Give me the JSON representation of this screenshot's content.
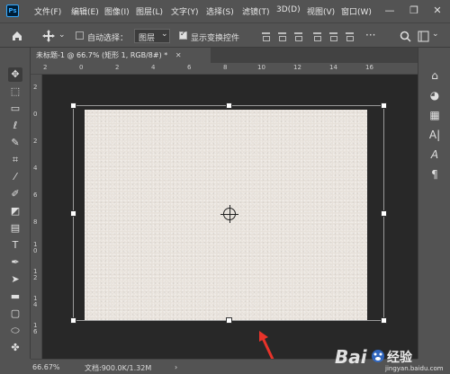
{
  "app": {
    "logo_text": "Ps"
  },
  "menu": {
    "items": [
      "文件(F)",
      "编辑(E)",
      "图像(I)",
      "图层(L)",
      "文字(Y)",
      "选择(S)",
      "滤镜(T)",
      "3D(D)",
      "视图(V)",
      "窗口(W)"
    ]
  },
  "window_controls": {
    "minimize": "—",
    "restore": "❐",
    "close": "✕"
  },
  "options": {
    "auto_select_label": "自动选择：",
    "auto_select_checked": false,
    "layer_select_value": "图层",
    "show_transform_label": "显示变换控件",
    "show_transform_checked": true
  },
  "document": {
    "tab_title": "未标题-1 @ 66.7% (矩形 1, RGB/8#) *",
    "canvas_color": "#e7e1da"
  },
  "rulers": {
    "top_labels": [
      "2",
      "0",
      "2",
      "4",
      "6",
      "8",
      "10",
      "12",
      "14",
      "16"
    ],
    "left_labels": [
      "2",
      "0",
      "2",
      "4",
      "6",
      "8",
      "1\n0",
      "1\n2",
      "1\n4",
      "1\n6"
    ]
  },
  "status": {
    "zoom": "66.67%",
    "doc_info": "文档:900.0K/1.32M"
  },
  "watermark": {
    "brand": "Bai",
    "suffix": "经验",
    "url": "jingyan.baidu.com"
  },
  "colors": {
    "accent_arrow": "#e8332a",
    "ps_blue": "#31a8ff"
  }
}
